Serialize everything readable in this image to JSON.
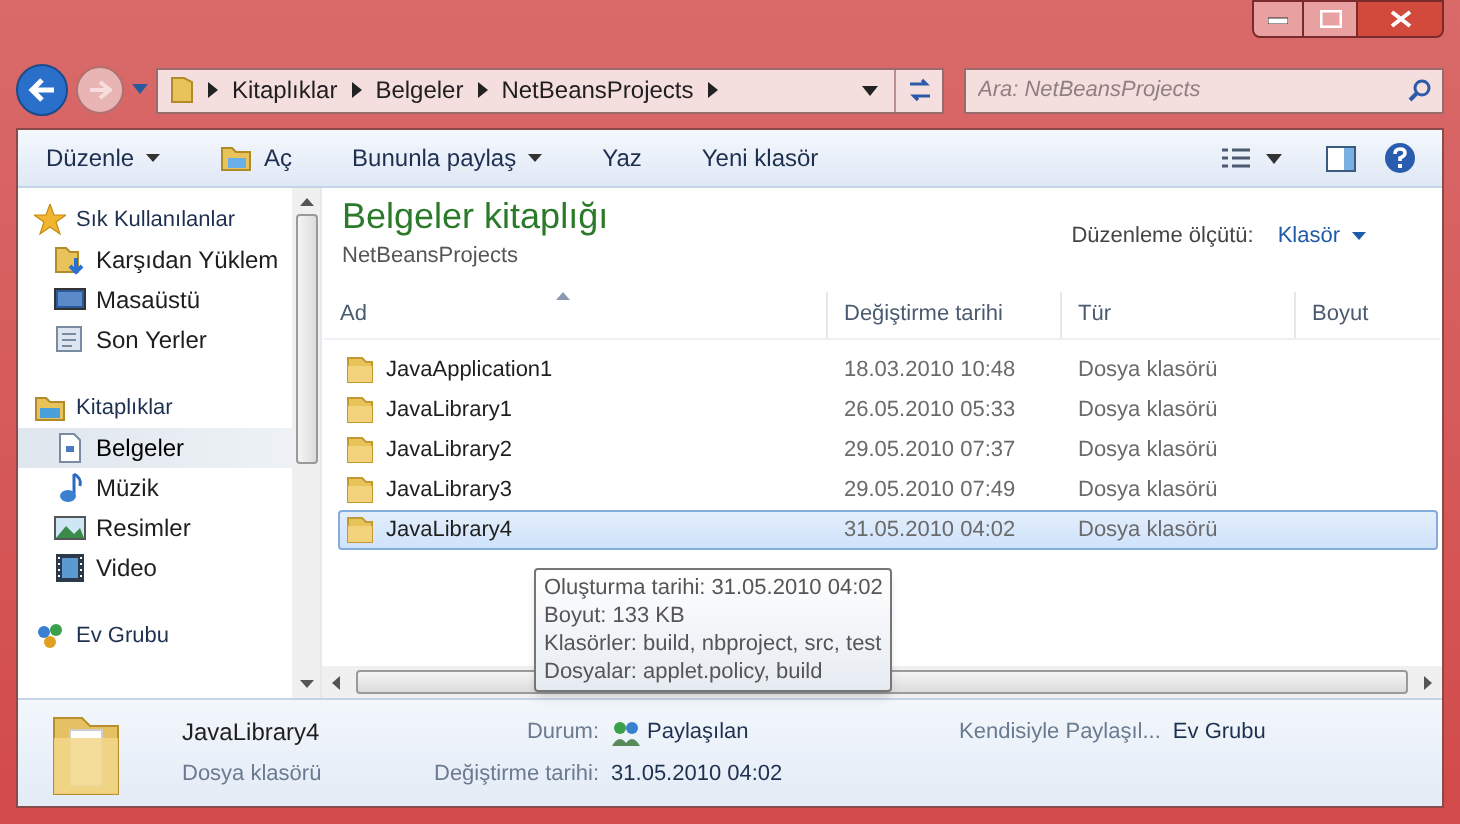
{
  "address_bar": {
    "crumbs": [
      "Kitaplıklar",
      "Belgeler",
      "NetBeansProjects"
    ]
  },
  "search": {
    "placeholder": "Ara: NetBeansProjects"
  },
  "toolbar": {
    "items": [
      {
        "label": "Düzenle",
        "kind": "menu"
      },
      {
        "label": "Aç",
        "kind": "icon"
      },
      {
        "label": "Bununla paylaş",
        "kind": "menu"
      },
      {
        "label": "Yaz",
        "kind": "plain"
      },
      {
        "label": "Yeni klasör",
        "kind": "plain"
      }
    ]
  },
  "sidebar": {
    "groups": [
      {
        "label": "Sık Kullanılanlar",
        "children": [
          {
            "label": "Karşıdan Yüklem",
            "selected": false
          },
          {
            "label": "Masaüstü",
            "selected": false
          },
          {
            "label": "Son Yerler",
            "selected": false
          }
        ]
      },
      {
        "label": "Kitaplıklar",
        "children": [
          {
            "label": "Belgeler",
            "selected": true
          },
          {
            "label": "Müzik",
            "selected": false
          },
          {
            "label": "Resimler",
            "selected": false
          },
          {
            "label": "Video",
            "selected": false
          }
        ]
      },
      {
        "label": "Ev Grubu"
      }
    ]
  },
  "library": {
    "title": "Belgeler kitaplığı",
    "subtitle": "NetBeansProjects",
    "arrange_label": "Düzenleme ölçütü:",
    "arrange_value": "Klasör"
  },
  "table": {
    "columns": [
      "Ad",
      "Değiştirme tarihi",
      "Tür",
      "Boyut"
    ],
    "rows": [
      {
        "name": "JavaApplication1",
        "date": "18.03.2010 10:48",
        "type": "Dosya klasörü",
        "selected": false
      },
      {
        "name": "JavaLibrary1",
        "date": "26.05.2010 05:33",
        "type": "Dosya klasörü",
        "selected": false
      },
      {
        "name": "JavaLibrary2",
        "date": "29.05.2010 07:37",
        "type": "Dosya klasörü",
        "selected": false
      },
      {
        "name": "JavaLibrary3",
        "date": "29.05.2010 07:49",
        "type": "Dosya klasörü",
        "selected": false
      },
      {
        "name": "JavaLibrary4",
        "date": "31.05.2010 04:02",
        "type": "Dosya klasörü",
        "selected": true
      }
    ]
  },
  "tooltip": {
    "lines": [
      "Oluşturma tarihi: 31.05.2010 04:02",
      "Boyut: 133 KB",
      "Klasörler: build, nbproject, src, test",
      "Dosyalar: applet.policy, build"
    ]
  },
  "details": {
    "name": "JavaLibrary4",
    "type": "Dosya klasörü",
    "status_label": "Durum:",
    "status_value": "Paylaşılan",
    "shared_label": "Kendisiyle Paylaşıl...",
    "shared_value": "Ev Grubu",
    "date_label": "Değiştirme tarihi:",
    "date_value": "31.05.2010 04:02"
  }
}
